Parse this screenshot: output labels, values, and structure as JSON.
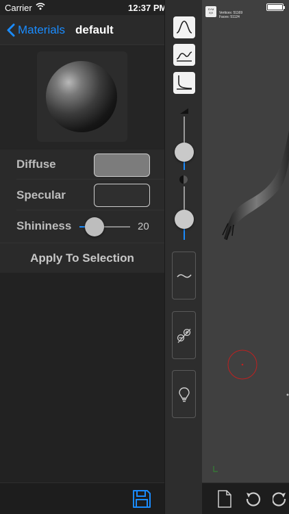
{
  "status_bar": {
    "carrier": "Carrier",
    "time": "12:37 PM"
  },
  "nav": {
    "back_label": "Materials",
    "title": "default"
  },
  "material": {
    "diffuse_label": "Diffuse",
    "diffuse_color": "#7c7c7c",
    "specular_label": "Specular",
    "specular_color": "#2f2f2f",
    "shininess_label": "Shininess",
    "shininess_value": "20",
    "apply_label": "Apply To Selection"
  },
  "viewport": {
    "sym_badge": "SYM X|X",
    "vertices_label": "Vertices:",
    "vertices_value": "51169",
    "faces_label": "Faces:",
    "faces_value": "51124"
  },
  "colors": {
    "accent": "#1a8cff",
    "panel": "#2a2a2a",
    "viewport": "#404040"
  },
  "icons": [
    "back-chevron-icon",
    "wifi-icon",
    "save-icon",
    "falloff-curve-icon",
    "brush-stroke-icon",
    "symmetry-icon",
    "lightbulb-icon",
    "new-document-icon",
    "undo-icon",
    "redo-icon",
    "battery-icon"
  ]
}
